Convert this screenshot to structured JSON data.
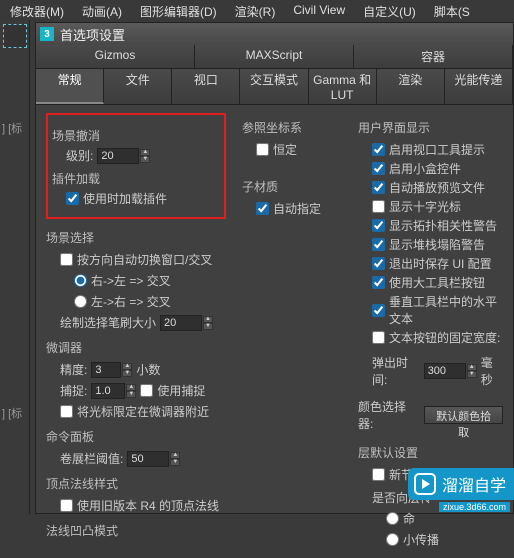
{
  "menu": [
    "修改器(M)",
    "动画(A)",
    "图形编辑器(D)",
    "渲染(R)",
    "Civil View",
    "自定义(U)",
    "脚本(S"
  ],
  "panel_labels": [
    "] [标",
    "] [标"
  ],
  "dialog_title": "首选项设置",
  "tabs1": [
    "Gizmos",
    "MAXScript",
    "容器"
  ],
  "tabs2": [
    "常规",
    "文件",
    "视口",
    "交互模式",
    "Gamma 和 LUT",
    "渲染",
    "光能传递"
  ],
  "active_tab": "常规",
  "col1": {
    "scene_undo": {
      "title": "场景撤消",
      "level_label": "级别:",
      "level_value": "20"
    },
    "plugin_load": {
      "title": "插件加载",
      "opt": "使用时加载插件"
    },
    "scene_select": {
      "title": "场景选择",
      "auto_switch": "按方向自动切换窗口/交叉",
      "r1": "右->左 => 交叉",
      "r2": "左->右 => 交叉",
      "brush_label": "绘制选择笔刷大小",
      "brush_value": "20"
    },
    "spinner": {
      "title": "微调器",
      "precision_label": "精度:",
      "precision_value": "3",
      "decimal": "小数",
      "snap_label": "捕捉:",
      "snap_value": "1.0",
      "use_snap": "使用捕捉",
      "lock": "将光标限定在微调器附近"
    },
    "cmd_panel": {
      "title": "命令面板",
      "thresh_label": "卷展栏阈值:",
      "thresh_value": "50"
    },
    "vertex_normal": {
      "title": "顶点法线样式",
      "opt": "使用旧版本 R4 的顶点法线"
    },
    "normal_mode": {
      "title": "法线凹凸模式"
    }
  },
  "col2": {
    "ref_coord": {
      "title": "参照坐标系",
      "opt": "恒定"
    },
    "sub_mat": {
      "title": "子材质",
      "opt": "自动指定"
    }
  },
  "col3": {
    "ui_display": {
      "title": "用户界面显示"
    },
    "opts": [
      "启用视口工具提示",
      "启用小盒控件",
      "自动播放预览文件",
      "显示十字光标",
      "显示拓扑相关性警告",
      "显示堆栈塌陷警告",
      "退出时保存 UI 配置",
      "使用大工具栏按钮",
      "垂直工具栏中的水平文本",
      "文本按钮的固定宽度:"
    ],
    "checked": [
      true,
      true,
      true,
      false,
      true,
      true,
      true,
      true,
      true,
      false
    ],
    "popup_time_label": "弹出时间:",
    "popup_time_value": "300",
    "ms": "毫秒",
    "color_picker_label": "颜色选择器:",
    "color_picker_btn": "默认颜色拾取",
    "layer_defaults": {
      "title": "层默认设置",
      "opt": "新节点默认为按层(D)",
      "sub1": "是否向层传",
      "sub2": "命",
      "sub3": "小传播"
    }
  },
  "watermark": {
    "brand": "溜溜自学",
    "url": "zixue.3d66.com"
  }
}
